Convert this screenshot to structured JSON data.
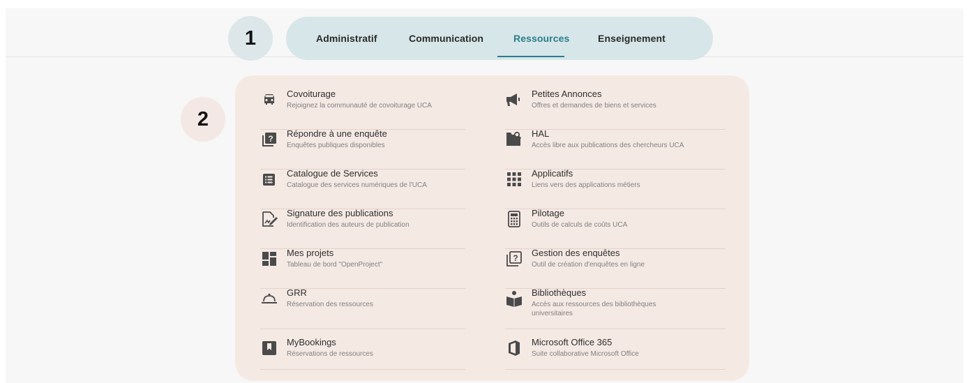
{
  "markers": [
    "1",
    "2"
  ],
  "tabs": [
    {
      "label": "Administratif"
    },
    {
      "label": "Communication"
    },
    {
      "label": "Ressources",
      "active": true
    },
    {
      "label": "Enseignement"
    }
  ],
  "colors": {
    "accent": "#2a7d8c",
    "tabs_bg": "#d7e6e8",
    "panel_bg": "#f5e9e4",
    "icon": "#4a4a4a"
  },
  "left_items": [
    {
      "icon": "car-icon",
      "title": "Covoiturage",
      "subtitle": "Rejoignez la communauté de covoiturage UCA"
    },
    {
      "icon": "survey-icon",
      "title": "Répondre à une enquête",
      "subtitle": "Enquêtes publiques disponibles"
    },
    {
      "icon": "list-icon",
      "title": "Catalogue de Services",
      "subtitle": "Catalogue des services numériques de l'UCA"
    },
    {
      "icon": "signature-icon",
      "title": "Signature des publications",
      "subtitle": "Identification des auteurs de publication"
    },
    {
      "icon": "dashboard-icon",
      "title": "Mes projets",
      "subtitle": "Tableau de bord \"OpenProject\""
    },
    {
      "icon": "cloche-icon",
      "title": "GRR",
      "subtitle": "Réservation des ressources"
    },
    {
      "icon": "bookmark-icon",
      "title": "MyBookings",
      "subtitle": "Réservations de ressources"
    }
  ],
  "right_items": [
    {
      "icon": "megaphone-icon",
      "title": "Petites Annonces",
      "subtitle": "Offres et demandes de biens et services"
    },
    {
      "icon": "folder-search-icon",
      "title": "HAL",
      "subtitle": "Accès libre aux publications des chercheurs UCA"
    },
    {
      "icon": "apps-grid-icon",
      "title": "Applicatifs",
      "subtitle": "Liens vers des applications métiers"
    },
    {
      "icon": "calculator-icon",
      "title": "Pilotage",
      "subtitle": "Outils de calculs de coûts UCA"
    },
    {
      "icon": "survey-outline-icon",
      "title": "Gestion des enquêtes",
      "subtitle": "Outil de création d'enquêtes en ligne"
    },
    {
      "icon": "library-icon",
      "title": "Bibliothèques",
      "subtitle": "Accès aux ressources des bibliothèques universitaires"
    },
    {
      "icon": "office-icon",
      "title": "Microsoft Office 365",
      "subtitle": "Suite collaborative Microsoft Office"
    }
  ]
}
